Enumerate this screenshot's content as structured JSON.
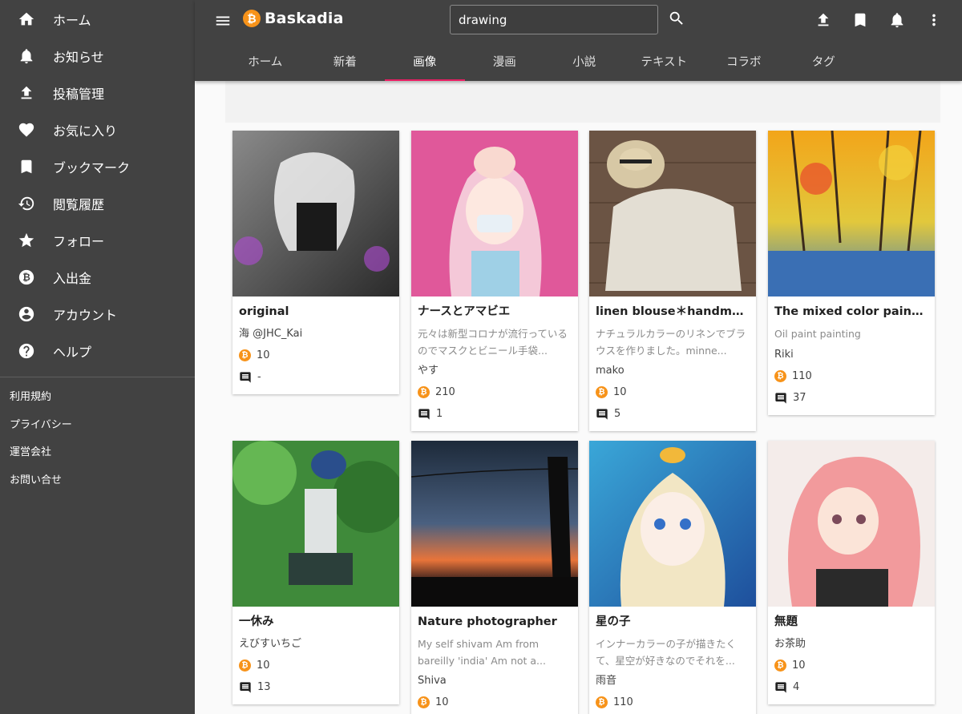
{
  "sidebar": {
    "items": [
      {
        "label": "ホーム",
        "icon": "home-icon"
      },
      {
        "label": "お知らせ",
        "icon": "bell-icon"
      },
      {
        "label": "投稿管理",
        "icon": "upload-icon"
      },
      {
        "label": "お気に入り",
        "icon": "heart-icon"
      },
      {
        "label": "ブックマーク",
        "icon": "bookmark-icon"
      },
      {
        "label": "閲覧履歴",
        "icon": "history-icon"
      },
      {
        "label": "フォロー",
        "icon": "star-icon"
      },
      {
        "label": "入出金",
        "icon": "bitcoin-icon"
      },
      {
        "label": "アカウント",
        "icon": "account-icon"
      },
      {
        "label": "ヘルプ",
        "icon": "help-icon"
      }
    ],
    "footer_links": [
      "利用規約",
      "プライバシー",
      "運営会社",
      "お問い合せ"
    ]
  },
  "header": {
    "brand": "Baskadia",
    "search_value": "drawing",
    "tabs": [
      "ホーム",
      "新着",
      "画像",
      "漫画",
      "小説",
      "テキスト",
      "コラボ",
      "タグ"
    ],
    "active_tab": "画像"
  },
  "colors": {
    "accent": "#e91e63",
    "bitcoin": "#f7931a",
    "bar": "#424242"
  },
  "cards": [
    {
      "title": "original",
      "desc": "",
      "author": "海 @JHC_Kai",
      "price": "10",
      "comments": "-"
    },
    {
      "title": "ナースとアマビエ",
      "desc": "元々は新型コロナが流行っているのでマスクとビニール手袋...",
      "author": "やす",
      "price": "210",
      "comments": "1"
    },
    {
      "title": "linen blouse＊handmade",
      "desc": "ナチュラルカラーのリネンでブラウスを作りました。minne...",
      "author": "mako",
      "price": "10",
      "comments": "5"
    },
    {
      "title": "The mixed color painting",
      "desc": "Oil paint painting",
      "author": "Riki",
      "price": "110",
      "comments": "37"
    },
    {
      "title": "一休み",
      "desc": "",
      "author": "えびすいちご",
      "price": "10",
      "comments": "13"
    },
    {
      "title": "Nature photographer",
      "desc": "My self shivam Am from bareilly 'india' Am not a...",
      "author": "Shiva",
      "price": "10",
      "comments": ""
    },
    {
      "title": "星の子",
      "desc": "インナーカラーの子が描きたくて、星空が好きなのでそれを...",
      "author": "雨音",
      "price": "110",
      "comments": ""
    },
    {
      "title": "無題",
      "desc": "",
      "author": "お茶助",
      "price": "10",
      "comments": "4"
    }
  ]
}
